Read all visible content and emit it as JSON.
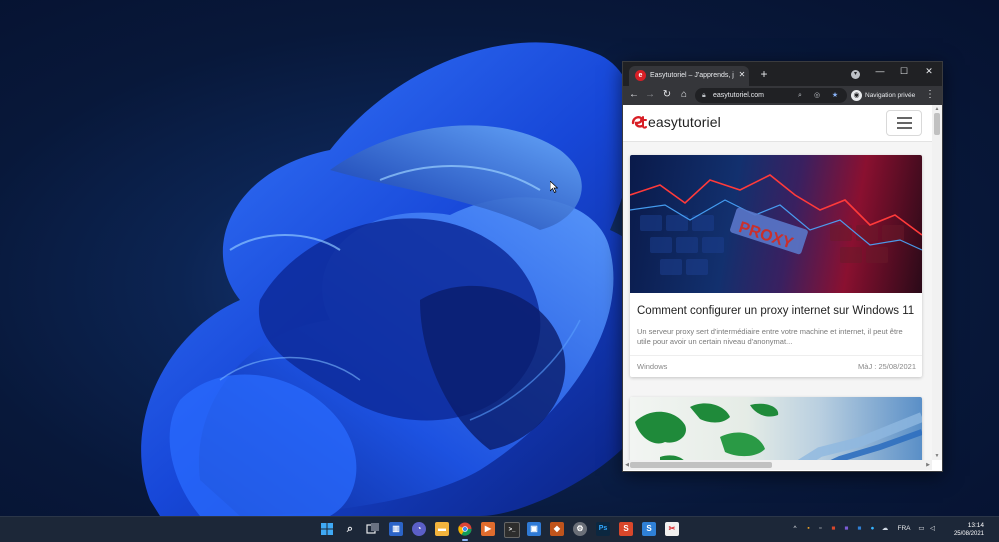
{
  "browser": {
    "tab_title": "Easytutoriel – J'apprends, je partage",
    "tab_close": "✕",
    "new_tab": "+",
    "window_controls": {
      "minimize": "—",
      "maximize": "☐",
      "close": "✕"
    },
    "url": "easytutoriel.com",
    "incognito_label": "Navigation privée",
    "menu": "⋮"
  },
  "site": {
    "logo_text": "easytutoriel",
    "brand_color": "#d81f26"
  },
  "articles": [
    {
      "image_text": "PROXY",
      "title": "Comment configurer un proxy internet sur Windows 11",
      "excerpt": "Un serveur proxy sert d'intermédiaire entre votre machine et internet, il peut être utile pour avoir un certain niveau d'anonymat...",
      "category": "Windows",
      "date": "MàJ : 25/08/2021"
    },
    {
      "image": "network-map"
    }
  ],
  "taskbar": {
    "icons": [
      "windows-start-icon",
      "search-icon",
      "task-view-icon",
      "widgets-icon",
      "chat-icon",
      "file-explorer-icon",
      "chrome-icon",
      "media-player-icon",
      "terminal-icon",
      "remote-desktop-icon",
      "app-icon",
      "settings-icon",
      "photoshop-icon",
      "app-s-red-icon",
      "app-s-blue-icon",
      "snipping-icon"
    ],
    "photoshop_label": "Ps",
    "tray": {
      "chevron": "^",
      "keyboard_lang": "FRA",
      "time": "13:14",
      "date": "25/08/2021"
    }
  }
}
